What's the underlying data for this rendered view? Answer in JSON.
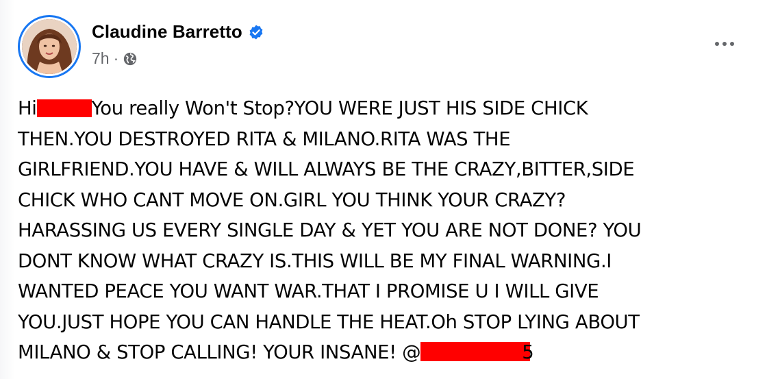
{
  "post": {
    "author": "Claudine Barretto",
    "time": "7h",
    "separator": "·",
    "audience_icon": "globe-icon",
    "verified_icon": "verified-badge-icon",
    "more_icon": "more-options-icon",
    "accent_color": "#1877f2",
    "body": {
      "l1_a": "Hi",
      "l1_b": "You really Won't Stop?YOU WERE JUST HIS SIDE CHICK",
      "l2": "THEN.YOU DESTROYED RITA & MILANO.RITA WAS THE",
      "l3": "GIRLFRIEND.YOU HAVE & WILL ALWAYS BE THE CRAZY,BITTER,SIDE",
      "l4": "CHICK WHO CANT MOVE ON.GIRL YOU THINK YOUR CRAZY?",
      "l5": "HARASSING US EVERY SINGLE DAY & YET YOU ARE NOT DONE? YOU",
      "l6": "DONT KNOW WHAT CRAZY IS.THIS WILL BE MY FINAL WARNING.I",
      "l7": "WANTED PEACE YOU WANT WAR.THAT I PROMISE U I WILL GIVE",
      "l8": "YOU.JUST HOPE YOU CAN HANDLE THE HEAT.Oh STOP LYING ABOUT",
      "l9_a": "MILANO & STOP CALLING! YOUR INSANE! @",
      "l9_b": "5"
    },
    "redaction_color": "#ff0000"
  }
}
